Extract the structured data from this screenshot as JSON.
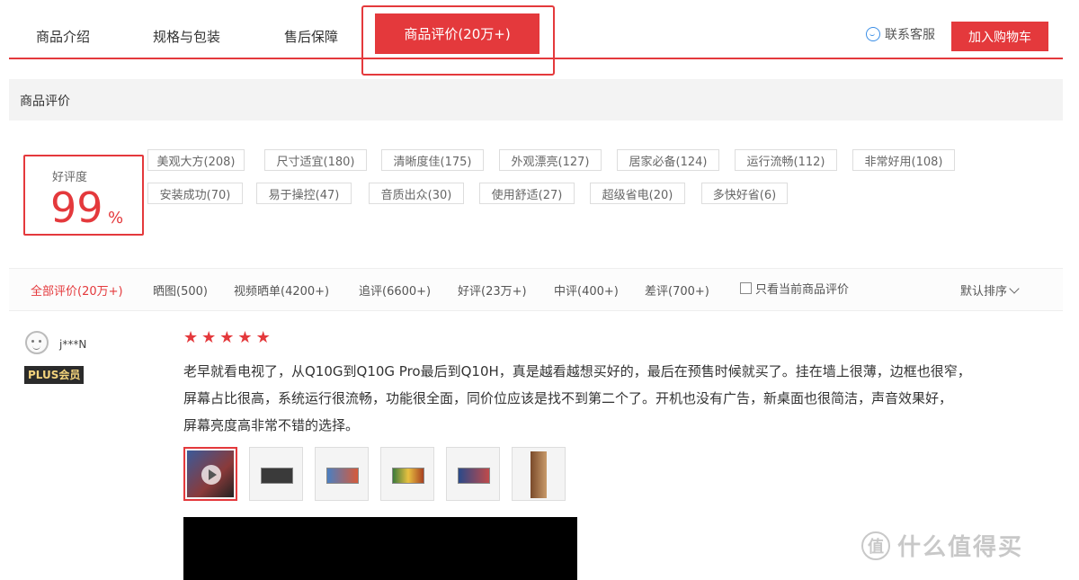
{
  "tabs": [
    {
      "label": "商品介绍"
    },
    {
      "label": "规格与包装"
    },
    {
      "label": "售后保障"
    },
    {
      "label": "商品评价(20万+)"
    }
  ],
  "header": {
    "contact_label": "联系客服",
    "cart_label": "加入购物车"
  },
  "section": {
    "title": "商品评价"
  },
  "rating": {
    "label": "好评度",
    "value": "99",
    "unit": "%"
  },
  "tags": [
    "美观大方(208)",
    "尺寸适宜(180)",
    "清晰度佳(175)",
    "外观漂亮(127)",
    "居家必备(124)",
    "运行流畅(112)",
    "非常好用(108)",
    "安装成功(70)",
    "易于操控(47)",
    "音质出众(30)",
    "使用舒适(27)",
    "超级省电(20)",
    "多快好省(6)"
  ],
  "filters": [
    "全部评价(20万+)",
    "晒图(500)",
    "视频晒单(4200+)",
    "追评(6600+)",
    "好评(23万+)",
    "中评(400+)",
    "差评(700+)"
  ],
  "only_current_label": "只看当前商品评价",
  "sort_label": "默认排序",
  "review": {
    "username": "j***N",
    "badge": "PLUS会员",
    "stars": 5,
    "lines": [
      "老早就看电视了，从Q10G到Q10G Pro最后到Q10H，真是越看越想买好的，最后在预售时候就买了。挂在墙上很薄，边框也很窄，",
      "屏幕占比很高，系统运行很流畅，功能很全面，同价位应该是找不到第二个了。开机也没有广告，新桌面也很简洁，声音效果好，",
      "屏幕亮度高非常不错的选择。"
    ]
  },
  "watermark": {
    "logo": "值",
    "text": "什么值得买"
  }
}
